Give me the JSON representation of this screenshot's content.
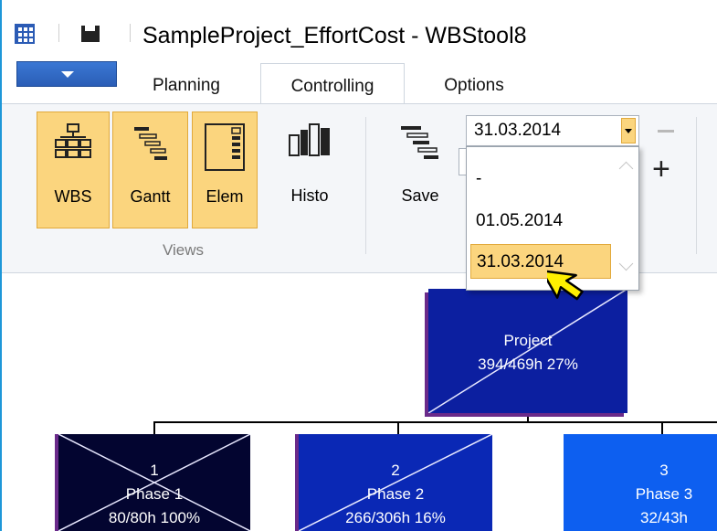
{
  "window": {
    "title": "SampleProject_EffortCost - WBStool8"
  },
  "tabs": [
    {
      "label": "Planning"
    },
    {
      "label": "Controlling"
    },
    {
      "label": "Options"
    }
  ],
  "ribbon": {
    "views_group_label": "Views",
    "buttons": {
      "wbs": "WBS",
      "gantt": "Gantt",
      "elem": "Elem",
      "histo": "Histo",
      "save": "Save"
    },
    "date_combo": {
      "value": "31.03.2014",
      "options": [
        "-",
        "01.05.2014",
        "31.03.2014"
      ],
      "selected": "31.03.2014"
    }
  },
  "wbs": {
    "project": {
      "name": "Project",
      "stats": "394/469h 27%",
      "color": "#0c1fa0"
    },
    "phases": [
      {
        "number": "1",
        "name": "Phase 1",
        "stats": "80/80h 100%",
        "color": "#030530"
      },
      {
        "number": "2",
        "name": "Phase 2",
        "stats": "266/306h 16%",
        "color": "#0a28b5"
      },
      {
        "number": "3",
        "name": "Phase 3",
        "stats": "32/43h",
        "color": "#0d5ff0"
      }
    ]
  },
  "colors": {
    "accent_blue": "#1e97d8",
    "selected_button": "#fbd57e"
  }
}
